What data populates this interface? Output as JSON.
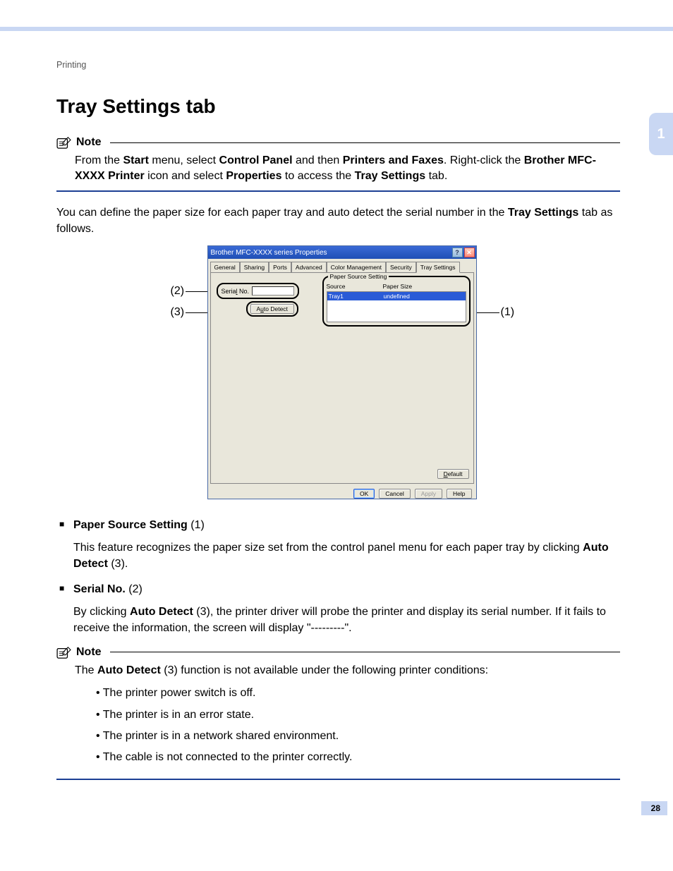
{
  "breadcrumb": "Printing",
  "side_tab": "1",
  "page_number": "28",
  "title": "Tray Settings tab",
  "note1_label": "Note",
  "note1_parts": {
    "p1": "From the ",
    "b1": "Start",
    "p2": " menu, select ",
    "b2": "Control Panel",
    "p3": " and then ",
    "b3": "Printers and Faxes",
    "p4": ". Right-click the ",
    "b4": "Brother MFC-XXXX Printer",
    "p5": " icon and select ",
    "b5": "Properties",
    "p6": " to access the ",
    "b6": "Tray Settings",
    "p7": " tab."
  },
  "intro": {
    "p1": "You can define the paper size for each paper tray and auto detect the serial number in the ",
    "b1": "Tray Settings",
    "p2": " tab as follows."
  },
  "callouts": {
    "c1": "(1)",
    "c2": "(2)",
    "c3": "(3)"
  },
  "dialog": {
    "title": "Brother  MFC-XXXX    series Properties",
    "tabs": [
      "General",
      "Sharing",
      "Ports",
      "Advanced",
      "Color Management",
      "Security",
      "Tray Settings"
    ],
    "serial_label_pre": "Seria",
    "serial_label_u": "l",
    "serial_label_post": " No.",
    "autodetect_pre": "A",
    "autodetect_u": "u",
    "autodetect_post": "to Detect",
    "paper_group_title": "Paper Source Setting",
    "paper_headers": {
      "source": "Source",
      "size": "Paper Size"
    },
    "paper_row": {
      "source": "Tray1",
      "size": "undefined"
    },
    "default_u": "D",
    "default_post": "efault",
    "buttons": {
      "ok": "OK",
      "cancel": "Cancel",
      "apply": "Apply",
      "help": "Help"
    }
  },
  "items": {
    "i1_b": "Paper Source Setting",
    "i1_n": " (1)",
    "i1_body_p1": "This feature recognizes the paper size set from the control panel menu for each paper tray by clicking ",
    "i1_body_b": "Auto Detect",
    "i1_body_p2": " (3).",
    "i2_b": "Serial No.",
    "i2_n": " (2)",
    "i2_body_p1": "By clicking ",
    "i2_body_b": "Auto Detect",
    "i2_body_p2": " (3), the printer driver will probe the printer and display its serial number. If it fails to receive the information, the screen will display \"---------\"."
  },
  "note2_label": "Note",
  "note2_intro_p1": "The ",
  "note2_intro_b": "Auto Detect",
  "note2_intro_p2": " (3) function is not available under the following printer conditions:",
  "note2_bullets": [
    "The printer power switch is off.",
    "The printer is in an error state.",
    "The printer is in a network shared environment.",
    "The cable is not connected to the printer correctly."
  ]
}
